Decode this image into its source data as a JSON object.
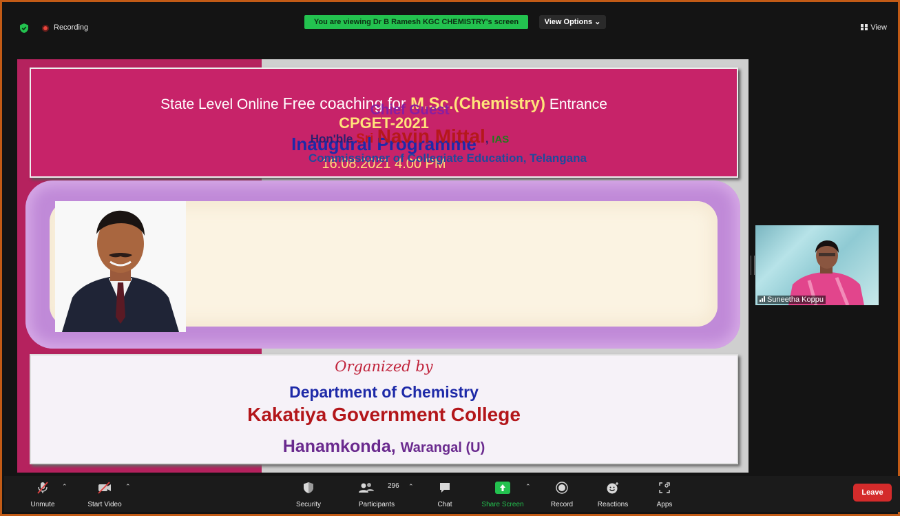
{
  "meeting": {
    "recording_label": "Recording",
    "viewing_banner": "You are viewing Dr B Ramesh KGC CHEMISTRY's screen",
    "view_options_label": "View Options",
    "view_label": "View"
  },
  "slide": {
    "title_line1_a": "State Level Online ",
    "title_line1_b": "Free coaching for ",
    "title_line1_c": "M.Sc.(Chemistry)",
    "title_line1_d": " Entrance",
    "title_line2": "CPGET-2021",
    "title_line3": "Inaugural Programme",
    "title_line4": "16.08.2021  4.00 PM",
    "chief_guest_label": "Chief Guest",
    "hon_prefix": "Hon'ble ",
    "sri": "Sri ",
    "guest_name": "Navin Mittal",
    "comma": ", ",
    "ias": "IAS",
    "guest_title": "Commissioner of Collegiate Education, Telangana",
    "organized_by": "Organized by",
    "department": "Department of Chemistry",
    "college": "Kakatiya Government College",
    "place_a": "Hanamkonda, ",
    "place_b": "Warangal (U)"
  },
  "participant": {
    "name": "Suneetha Koppu"
  },
  "toolbar": {
    "unmute": "Unmute",
    "start_video": "Start Video",
    "security": "Security",
    "participants": "Participants",
    "participant_count": "296",
    "chat": "Chat",
    "share_screen": "Share Screen",
    "record": "Record",
    "reactions": "Reactions",
    "apps": "Apps",
    "leave": "Leave"
  },
  "colors": {
    "frame_border": "#c25b16",
    "viewing_banner": "#23c24f",
    "leave_button": "#d42b2b",
    "slide_title_bg": "#c72369"
  }
}
